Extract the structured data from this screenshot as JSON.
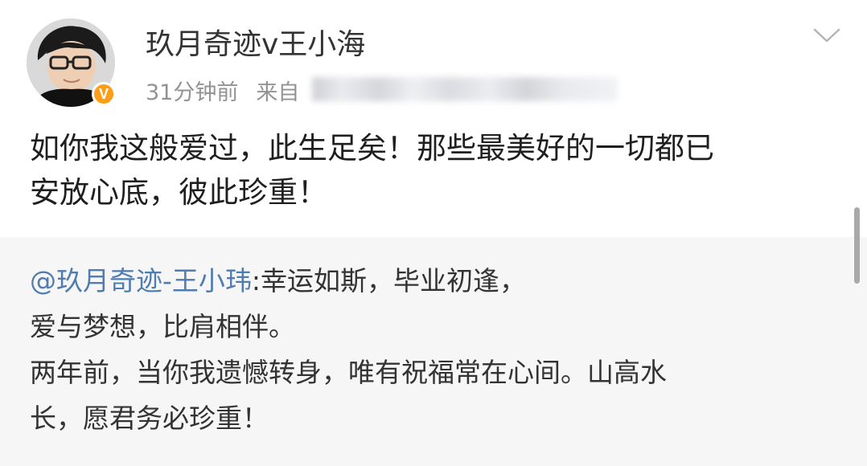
{
  "post": {
    "author": {
      "name": "玖月奇迹v王小海",
      "avatar": "avatar-photo",
      "verified_badge": "V",
      "badge_color": "#ff9e16"
    },
    "meta": {
      "time": "31分钟前",
      "source_prefix": "来自"
    },
    "text_line1": "如你我这般爱过，此生足矣！那些最美好的一切都已",
    "text_line2": "安放心底，彼此珍重！",
    "menu_icon": "chevron-down-icon"
  },
  "retweet": {
    "mention": "@玖月奇迹-王小玮",
    "line1_rest": ":幸运如斯，毕业初逢，",
    "line2": "爱与梦想，比肩相伴。",
    "line3": "两年前，当你我遗憾转身，唯有祝福常在心间。山高水",
    "line4": "长，愿君务必珍重！",
    "mention_color": "#507daf",
    "background": "#f6f6f6"
  }
}
